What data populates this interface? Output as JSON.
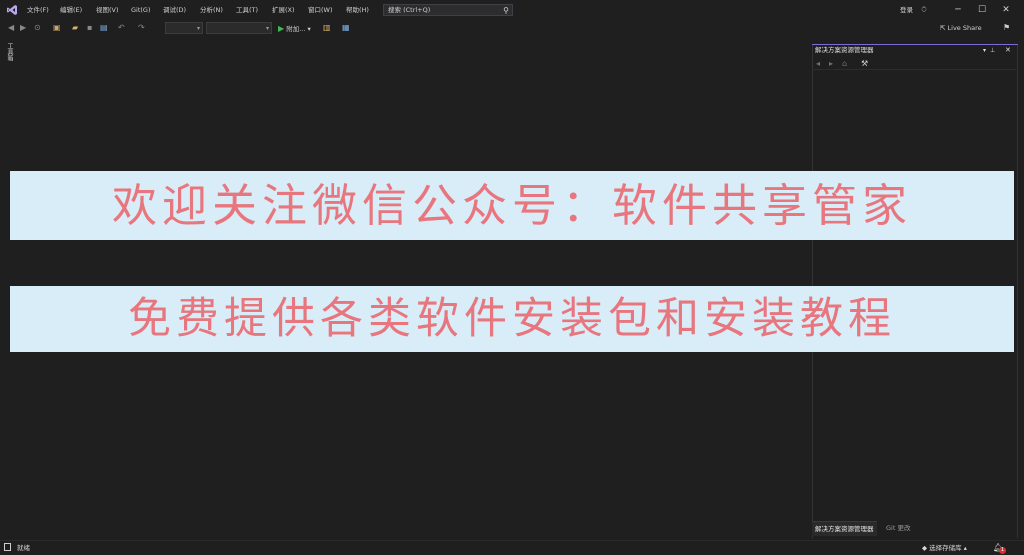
{
  "titlebar": {
    "menus": [
      "文件(F)",
      "编辑(E)",
      "视图(V)",
      "Git(G)",
      "调试(D)",
      "分析(N)",
      "工具(T)",
      "扩展(X)",
      "窗口(W)",
      "帮助(H)"
    ],
    "search_placeholder": "搜索 (Ctrl+Q)",
    "login_label": "登录"
  },
  "toolbar": {
    "attach_label": "附加...",
    "live_share_label": "Live Share"
  },
  "left_strip": {
    "toolbox_label": "工具箱"
  },
  "solution_explorer": {
    "title": "解决方案资源管理器",
    "tabs": [
      "解决方案资源管理器",
      "Git 更改"
    ]
  },
  "statusbar": {
    "status": "就绪",
    "repo_label": "选择存储库",
    "notification_count": "1"
  },
  "banners": {
    "line1": "欢迎关注微信公众号：软件共享管家",
    "line2": "免费提供各类软件安装包和安装教程"
  },
  "colors": {
    "banner_bg": "#d8edf7",
    "banner_text": "#e8767e",
    "ide_bg": "#1f1f1f",
    "accent": "#7c6ad6"
  }
}
